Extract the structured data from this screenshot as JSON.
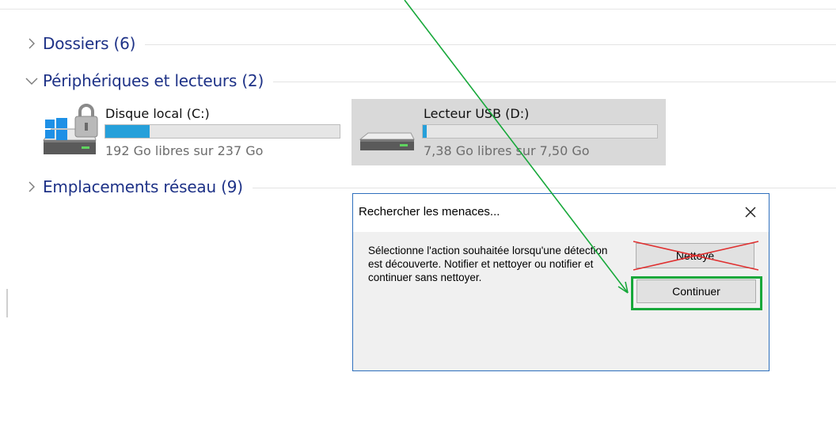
{
  "explorer": {
    "groups": [
      {
        "label": "Dossiers (6)",
        "expanded": false
      },
      {
        "label": "Périphériques et lecteurs (2)",
        "expanded": true
      },
      {
        "label": "Emplacements réseau (9)",
        "expanded": false
      }
    ],
    "drives": [
      {
        "name": "Disque local (C:)",
        "free_text": "192 Go libres sur 237 Go",
        "used_fraction": 0.19,
        "icon": "windows-locked-drive-icon",
        "selected": false
      },
      {
        "name": "Lecteur USB (D:)",
        "free_text": "7,38 Go libres sur 7,50 Go",
        "used_fraction": 0.016,
        "icon": "usb-drive-icon",
        "selected": true
      }
    ]
  },
  "dialog": {
    "title": "Rechercher les menaces...",
    "message": "Sélectionne l'action souhaitée lorsqu'une détection est découverte. Notifier et nettoyer ou notifier et continuer sans nettoyer.",
    "buttons": {
      "clean_label": "Nettoyé",
      "continue_label": "Continuer"
    },
    "close_icon": "close-icon"
  },
  "annotations": {
    "arrow_color": "#17a83a",
    "strike_color": "#e03030",
    "highlight_color": "#17a83a"
  },
  "colors": {
    "group_label": "#1e3287",
    "bar_fill": "#26a0da",
    "dialog_border": "#2e6fbd"
  }
}
